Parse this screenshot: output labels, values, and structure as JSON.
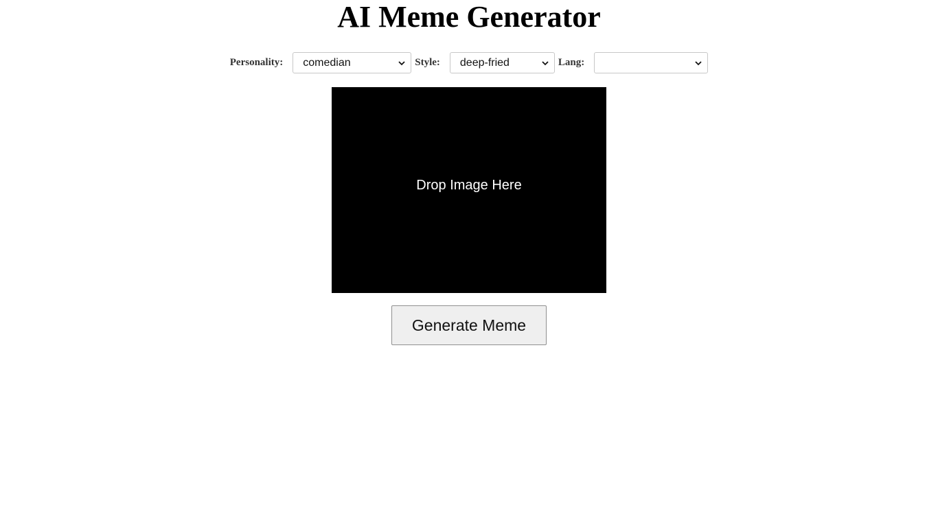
{
  "page": {
    "title": "AI Meme Generator"
  },
  "controls": {
    "personality": {
      "label": "Personality:",
      "selected": "comedian"
    },
    "style": {
      "label": "Style:",
      "selected": "deep-fried"
    },
    "lang": {
      "label": "Lang:",
      "selected": ""
    },
    "icons": {
      "dropdown": "chevron-down-icon"
    }
  },
  "drop_zone": {
    "text": "Drop Image Here",
    "background": "#000000",
    "text_color": "#ffffff"
  },
  "actions": {
    "generate_label": "Generate Meme"
  }
}
